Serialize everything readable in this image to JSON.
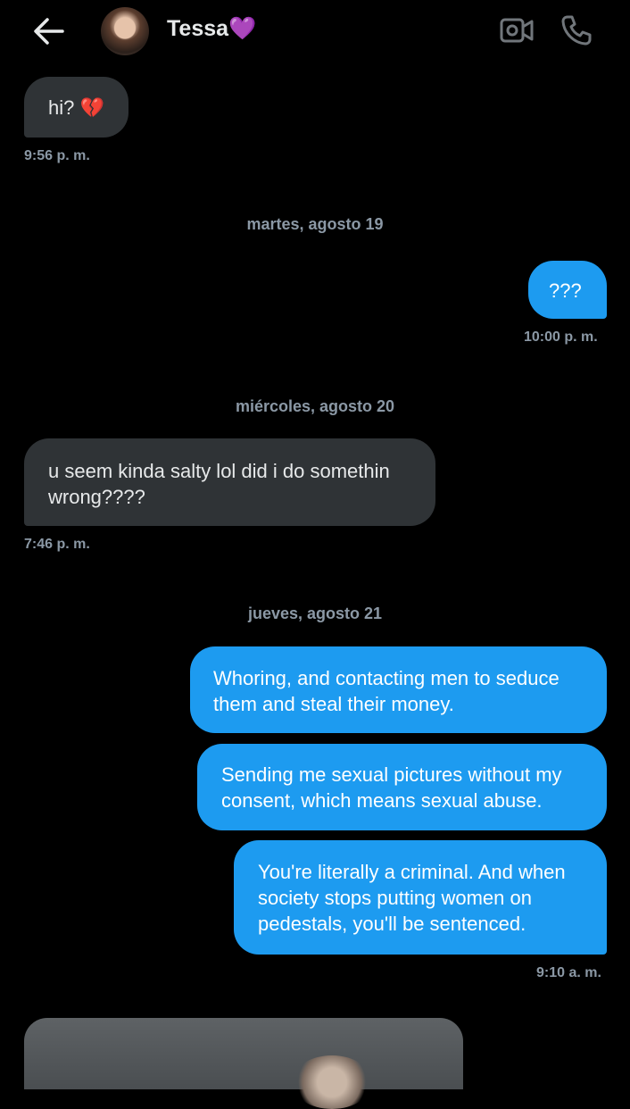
{
  "header": {
    "contact_name": "Tessa",
    "contact_emoji": "💜",
    "icons": [
      "back-arrow-icon",
      "avatar",
      "video-call-icon",
      "phone-call-icon"
    ]
  },
  "messages": {
    "m1": {
      "text": "hi? 💔",
      "time": "9:56 p. m."
    },
    "date1": "martes, agosto 19",
    "m2": {
      "text": "???",
      "time": "10:00 p. m."
    },
    "date2": "miércoles, agosto 20",
    "m3": {
      "text": "u seem kinda salty lol did i do somethin wrong????",
      "time": "7:46 p. m."
    },
    "date3": "jueves, agosto 21",
    "m4": {
      "text": "Whoring, and contacting men to seduce them and steal their money."
    },
    "m5": {
      "text": "Sending me sexual pictures without my consent, which means sexual abuse."
    },
    "m6": {
      "text": "You're literally a criminal. And when society stops putting women on pedestals, you'll be sentenced.",
      "time": "9:10 a. m."
    }
  },
  "colors": {
    "background": "#000000",
    "incoming_bubble": "#2f3336",
    "outgoing_bubble": "#1d9bf0",
    "timestamp": "#8b98a5"
  }
}
